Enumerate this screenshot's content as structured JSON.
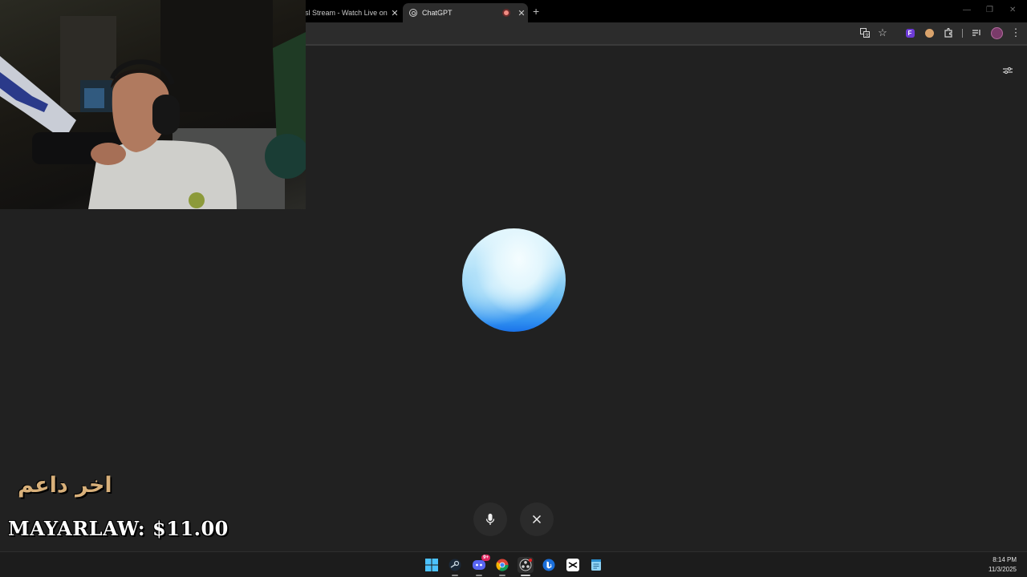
{
  "browser": {
    "tabs": [
      {
        "title": "sl Stream - Watch Live on",
        "active": false
      },
      {
        "title": "ChatGPT",
        "active": true
      }
    ],
    "new_tab_symbol": "+",
    "toolbar_icons": [
      "translate-icon",
      "star-icon",
      "extension-f-icon",
      "extension-cookie-icon",
      "extensions-puzzle-icon",
      "media-queue-icon",
      "profile-avatar-icon",
      "more-menu-icon"
    ]
  },
  "voice_mode": {
    "orb_colors": [
      "#e6f8fe",
      "#6fc0f2",
      "#1a73ea"
    ],
    "buttons": [
      "microphone-icon",
      "close-icon"
    ]
  },
  "stream_overlay": {
    "arabic_caption": "اخر داعم",
    "donation_text": "MAYARLAW: $11.00",
    "caption_color": "#d8b07a"
  },
  "taskbar": {
    "apps": [
      "windows-start-icon",
      "steam-icon",
      "discord-icon",
      "chrome-icon",
      "obs-icon",
      "bing-icon",
      "capcut-icon",
      "notepad-icon"
    ],
    "discord_badge": "9+",
    "clock_time": "8:14 PM",
    "clock_date": "11/3/2025"
  }
}
